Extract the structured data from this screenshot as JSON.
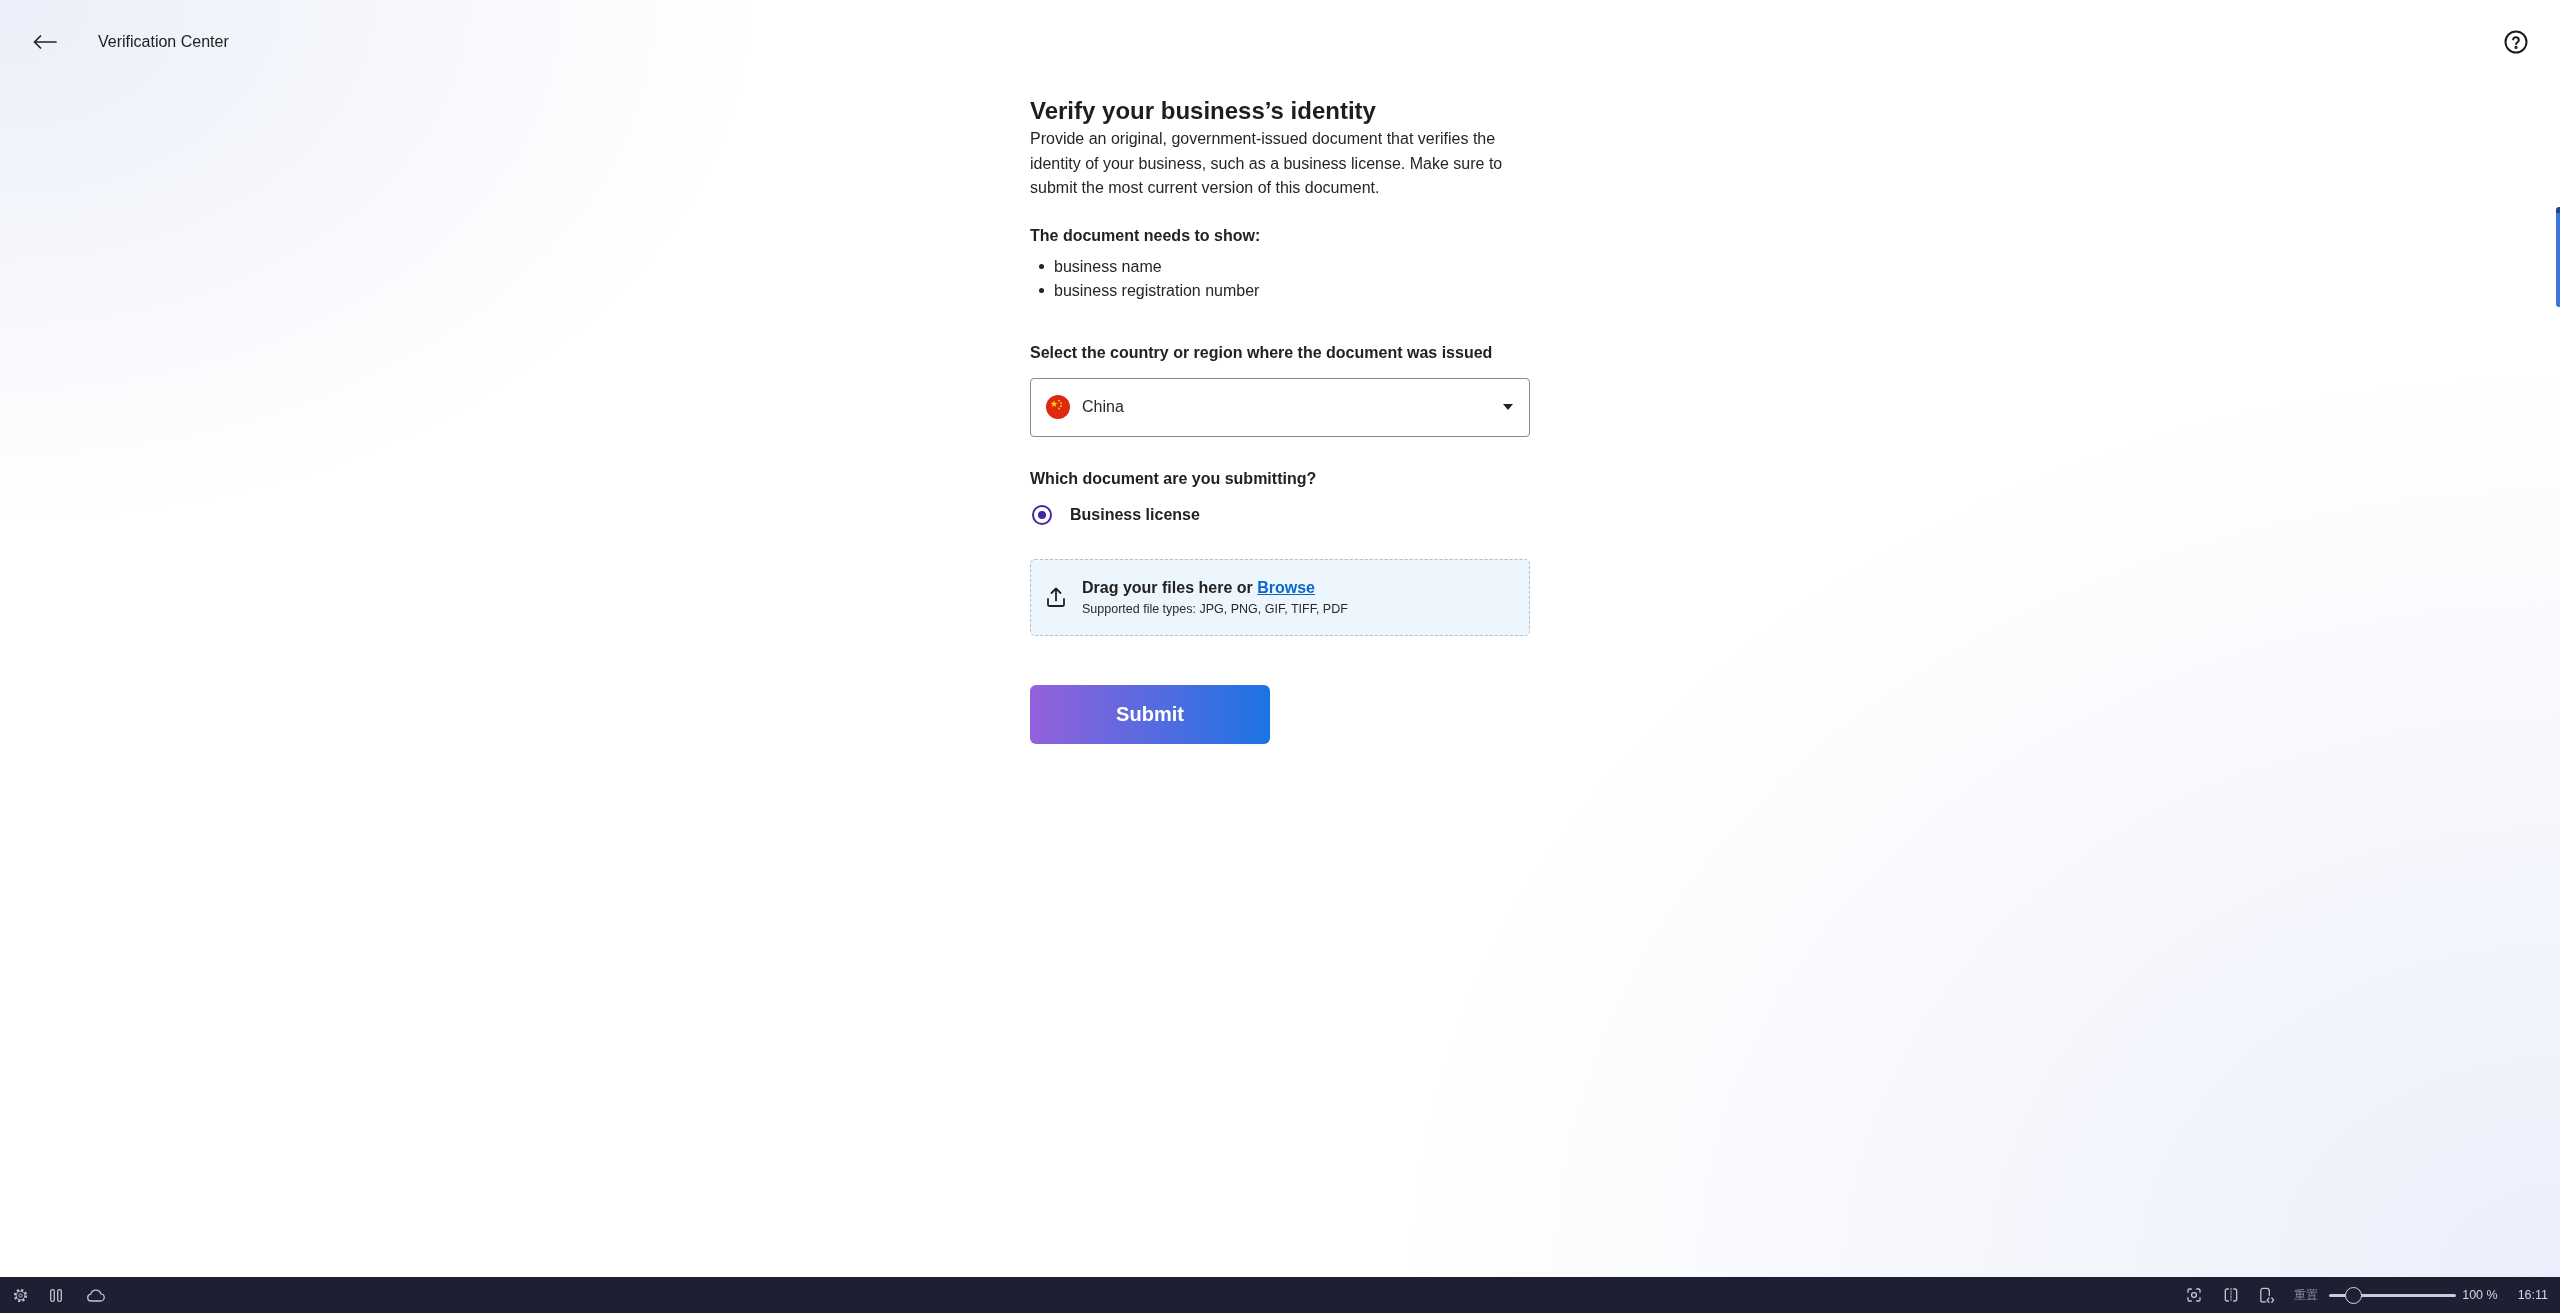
{
  "header": {
    "title": "Verification Center"
  },
  "form": {
    "heading": "Verify your business’s identity",
    "description": "Provide an original, government-issued document that verifies the identity of your business, such as a business license. Make sure to submit the most current version of this document.",
    "requirements": {
      "title": "The document needs to show:",
      "items": [
        "business name",
        "business registration number"
      ]
    },
    "country_select": {
      "label": "Select the country or region where the document was issued",
      "value": "China"
    },
    "document_type": {
      "label": "Which document are you submitting?",
      "options": [
        {
          "label": "Business license",
          "selected": true
        }
      ]
    },
    "upload": {
      "prompt": "Drag your files here or",
      "link": "Browse",
      "hint": "Supported file types: JPG, PNG, GIF, TIFF, PDF"
    },
    "submit": "Submit"
  },
  "taskbar": {
    "reset_label": "重置",
    "zoom_slider": {
      "level": 0.19
    },
    "zoom_reading": "100 %",
    "clock": "16:11"
  }
}
